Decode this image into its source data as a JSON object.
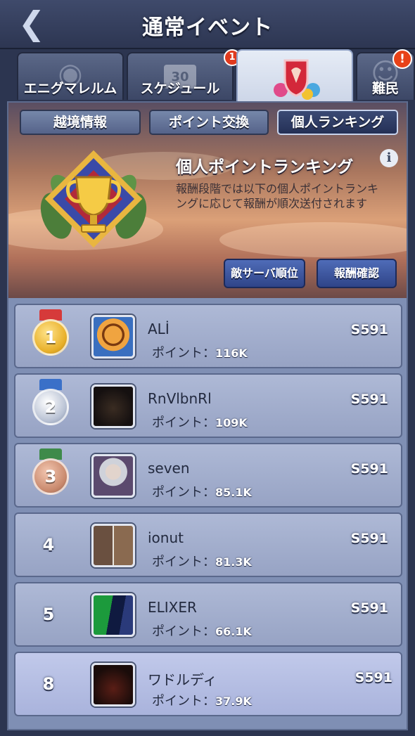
{
  "header": {
    "title": "通常イベント"
  },
  "tabs": [
    {
      "label": "エニグマレルム",
      "icon": "bear-icon"
    },
    {
      "label": "スケジュール",
      "icon": "calendar-icon",
      "badge": "1",
      "calendar_day": "30"
    },
    {
      "label": "",
      "icon": "crest-shield-icon"
    },
    {
      "label": "難民",
      "icon": "refugee-icon",
      "alert": "!"
    }
  ],
  "subtabs": [
    "越境情報",
    "ポイント交換",
    "個人ランキング"
  ],
  "banner": {
    "title": "個人ポイントランキング",
    "description": "報酬段階では以下の個人ポイントランキングに応じて報酬が順次送付されます",
    "buttons": [
      "敵サーバ順位",
      "報酬確認"
    ]
  },
  "points_label": "ポイント：",
  "rankings": [
    {
      "rank": "1",
      "name": "ALİ",
      "points": "116K",
      "server": "S591",
      "medal": "gold"
    },
    {
      "rank": "2",
      "name": "RnVlbnRl",
      "points": "109K",
      "server": "S591",
      "medal": "silver"
    },
    {
      "rank": "3",
      "name": "seven",
      "points": "85.1K",
      "server": "S591",
      "medal": "bronze"
    },
    {
      "rank": "4",
      "name": "ionut",
      "points": "81.3K",
      "server": "S591"
    },
    {
      "rank": "5",
      "name": "ELIXER",
      "points": "66.1K",
      "server": "S591"
    },
    {
      "rank": "8",
      "name": "ワドルディ",
      "points": "37.9K",
      "server": "S591",
      "is_self": true
    }
  ],
  "colors": {
    "gold": "#e8b02a",
    "silver": "#b9c2d4",
    "bronze": "#c98a6e"
  }
}
